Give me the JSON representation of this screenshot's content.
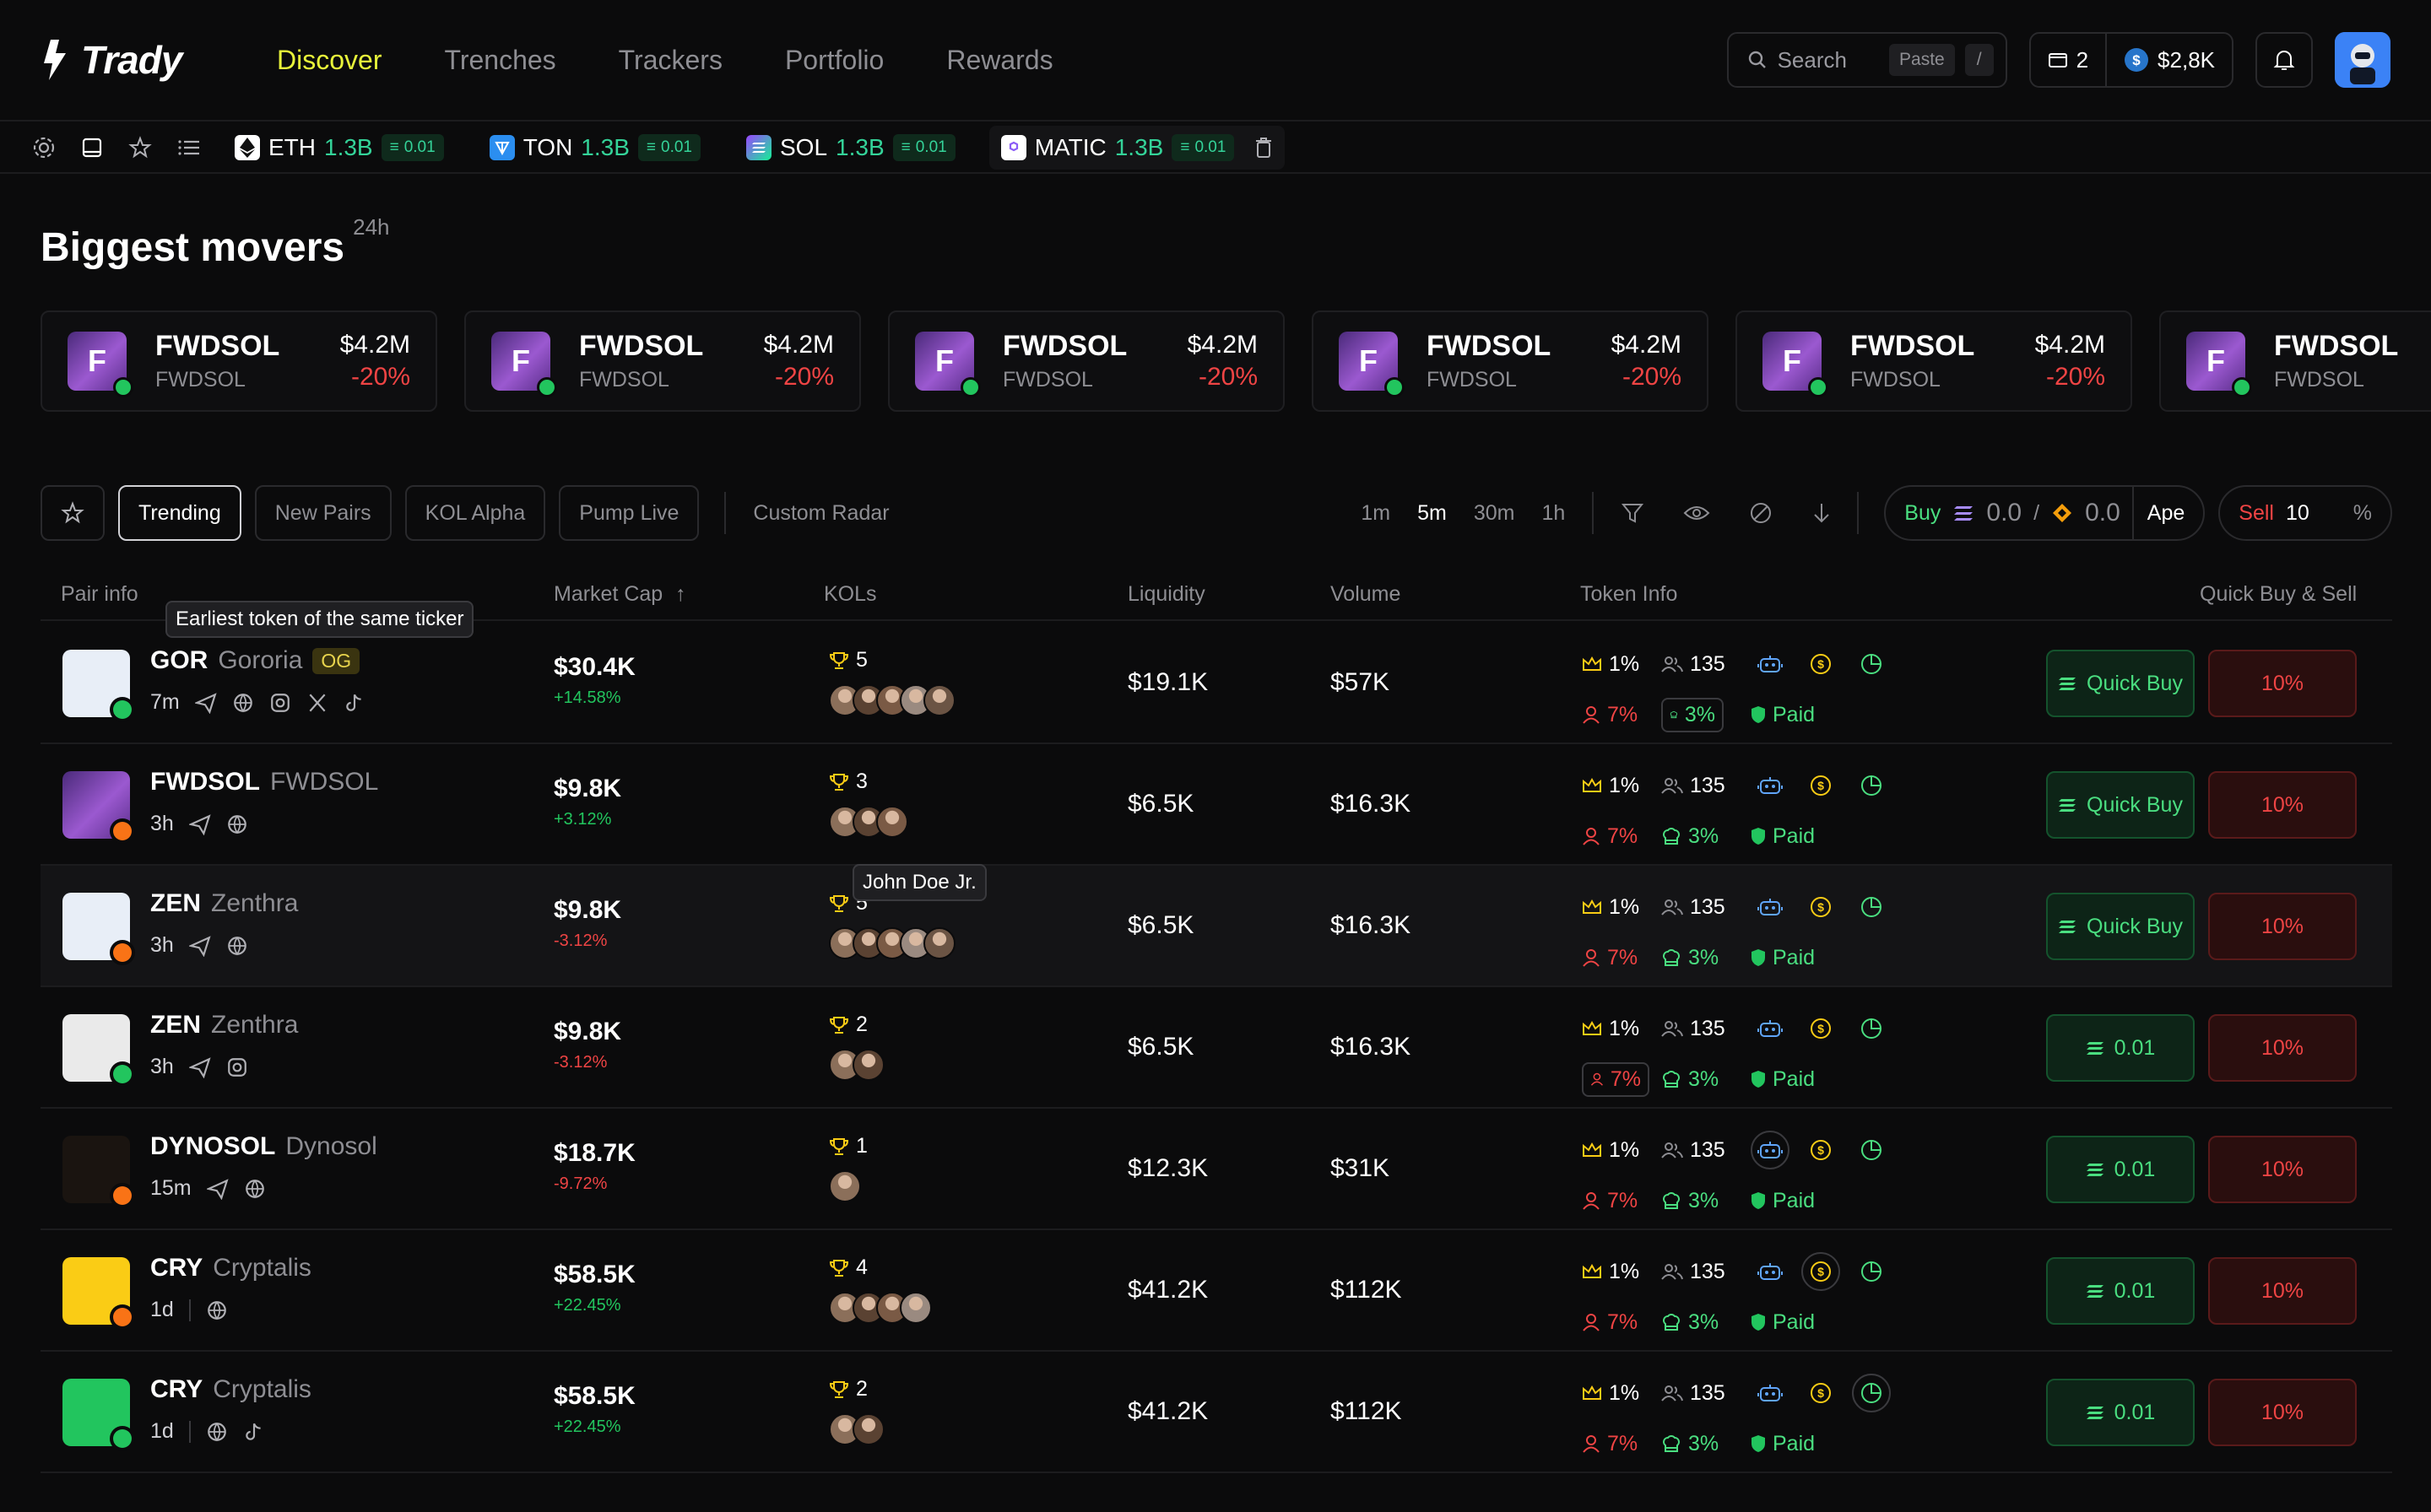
{
  "brand": {
    "name": "Trady"
  },
  "nav": {
    "items": [
      "Discover",
      "Trenches",
      "Trackers",
      "Portfolio",
      "Rewards"
    ],
    "active": "Discover"
  },
  "search": {
    "placeholder": "Search",
    "paste_label": "Paste",
    "shortcut": "/"
  },
  "wallet": {
    "count": "2",
    "balance": "$2,8K"
  },
  "chains": [
    {
      "name": "ETH",
      "value": "1.3B",
      "fee": "0.01",
      "icon": "eth-icon",
      "color": "#ffffff"
    },
    {
      "name": "TON",
      "value": "1.3B",
      "fee": "0.01",
      "icon": "ton-icon",
      "color": "#2b8ef0"
    },
    {
      "name": "SOL",
      "value": "1.3B",
      "fee": "0.01",
      "icon": "sol-icon",
      "color": "#a855f7"
    },
    {
      "name": "MATIC",
      "value": "1.3B",
      "fee": "0.01",
      "icon": "matic-icon",
      "color": "#8b5cf6"
    }
  ],
  "movers": {
    "title": "Biggest movers",
    "period": "24h",
    "cards": [
      {
        "symbol": "FWDSOL",
        "name": "FWDSOL",
        "mcap": "$4.2M",
        "change": "-20%"
      },
      {
        "symbol": "FWDSOL",
        "name": "FWDSOL",
        "mcap": "$4.2M",
        "change": "-20%"
      },
      {
        "symbol": "FWDSOL",
        "name": "FWDSOL",
        "mcap": "$4.2M",
        "change": "-20%"
      },
      {
        "symbol": "FWDSOL",
        "name": "FWDSOL",
        "mcap": "$4.2M",
        "change": "-20%"
      },
      {
        "symbol": "FWDSOL",
        "name": "FWDSOL",
        "mcap": "$4.2M",
        "change": "-20%"
      },
      {
        "symbol": "FWDSOL",
        "name": "FWDSOL",
        "mcap": "",
        "change": ""
      }
    ]
  },
  "filters": {
    "tabs": [
      "Trending",
      "New Pairs",
      "KOL Alpha",
      "Pump Live"
    ],
    "active_tab": "Trending",
    "custom": "Custom Radar",
    "timeframes": [
      "1m",
      "5m",
      "30m",
      "1h"
    ],
    "active_timeframe": "5m",
    "buy_label": "Buy",
    "buy_amount_1": "0.0",
    "buy_amount_2": "0.0",
    "ape_label": "Ape",
    "sell_label": "Sell",
    "sell_amount": "10",
    "sell_unit": "%"
  },
  "table": {
    "headers": [
      "Pair info",
      "Market Cap",
      "KOLs",
      "Liquidity",
      "Volume",
      "Token Info",
      "Quick Buy & Sell"
    ],
    "tooltips": {
      "earliest": "Earliest token of the same ticker",
      "kol_name": "John Doe Jr."
    },
    "rows": [
      {
        "ticker": "GOR",
        "name": "Gororia",
        "tag": "OG",
        "age": "7m",
        "mcap": "$30.4K",
        "change": "+14.58%",
        "dir": "up",
        "kols": "5",
        "kol_avatars": 5,
        "liq": "$19.1K",
        "vol": "$57K",
        "top": "1%",
        "holders": "135",
        "dev": "7%",
        "snipers": "3%",
        "paid": "Paid",
        "buy": "Quick Buy",
        "sell": "10%"
      },
      {
        "ticker": "FWDSOL",
        "name": "FWDSOL",
        "tag": "",
        "age": "3h",
        "mcap": "$9.8K",
        "change": "+3.12%",
        "dir": "up",
        "kols": "3",
        "kol_avatars": 3,
        "liq": "$6.5K",
        "vol": "$16.3K",
        "top": "1%",
        "holders": "135",
        "dev": "7%",
        "snipers": "3%",
        "paid": "Paid",
        "buy": "Quick Buy",
        "sell": "10%"
      },
      {
        "ticker": "ZEN",
        "name": "Zenthra",
        "tag": "",
        "age": "3h",
        "mcap": "$9.8K",
        "change": "-3.12%",
        "dir": "down",
        "kols": "5",
        "kol_avatars": 5,
        "liq": "$6.5K",
        "vol": "$16.3K",
        "top": "1%",
        "holders": "135",
        "dev": "7%",
        "snipers": "3%",
        "paid": "Paid",
        "buy": "Quick Buy",
        "sell": "10%"
      },
      {
        "ticker": "ZEN",
        "name": "Zenthra",
        "tag": "",
        "age": "3h",
        "mcap": "$9.8K",
        "change": "-3.12%",
        "dir": "down",
        "kols": "2",
        "kol_avatars": 2,
        "liq": "$6.5K",
        "vol": "$16.3K",
        "top": "1%",
        "holders": "135",
        "dev": "7%",
        "snipers": "3%",
        "paid": "Paid",
        "buy": "0.01",
        "sell": "10%"
      },
      {
        "ticker": "DYNOSOL",
        "name": "Dynosol",
        "tag": "",
        "age": "15m",
        "mcap": "$18.7K",
        "change": "-9.72%",
        "dir": "down",
        "kols": "1",
        "kol_avatars": 1,
        "liq": "$12.3K",
        "vol": "$31K",
        "top": "1%",
        "holders": "135",
        "dev": "7%",
        "snipers": "3%",
        "paid": "Paid",
        "buy": "0.01",
        "sell": "10%"
      },
      {
        "ticker": "CRY",
        "name": "Cryptalis",
        "tag": "",
        "age": "1d",
        "mcap": "$58.5K",
        "change": "+22.45%",
        "dir": "up",
        "kols": "4",
        "kol_avatars": 4,
        "liq": "$41.2K",
        "vol": "$112K",
        "top": "1%",
        "holders": "135",
        "dev": "7%",
        "snipers": "3%",
        "paid": "Paid",
        "buy": "0.01",
        "sell": "10%"
      },
      {
        "ticker": "CRY",
        "name": "Cryptalis",
        "tag": "",
        "age": "1d",
        "mcap": "$58.5K",
        "change": "+22.45%",
        "dir": "up",
        "kols": "2",
        "kol_avatars": 2,
        "liq": "$41.2K",
        "vol": "$112K",
        "top": "1%",
        "holders": "135",
        "dev": "7%",
        "snipers": "3%",
        "paid": "Paid",
        "buy": "0.01",
        "sell": "10%"
      }
    ]
  },
  "colors": {
    "accent": "#e8f53a",
    "positive": "#22c55e",
    "negative": "#ef4444"
  }
}
